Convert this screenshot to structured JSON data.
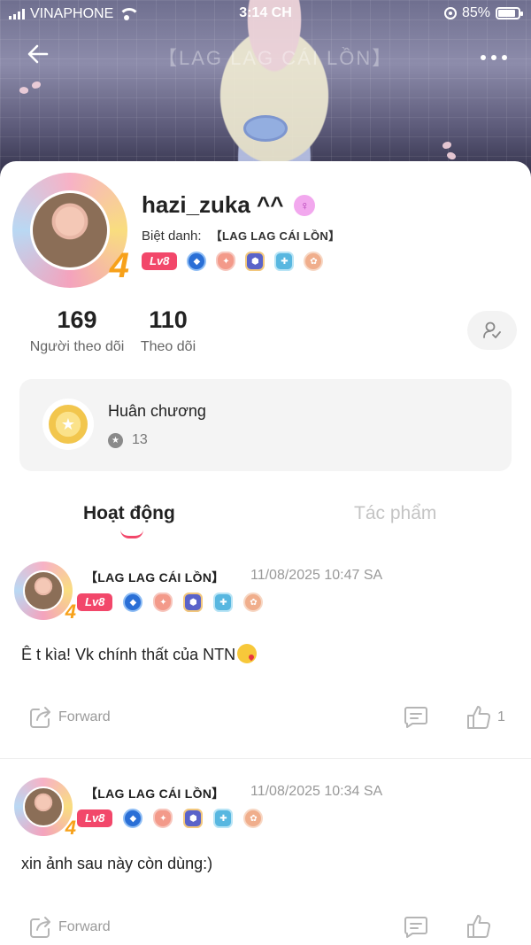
{
  "status_bar": {
    "carrier": "VINAPHONE",
    "time": "3:14 CH",
    "battery_percent": "85%"
  },
  "banner": {
    "background_text": "【LAG LAG CÁI LỒN】"
  },
  "profile": {
    "username": "hazi_zuka ^^",
    "nickname_label": "Biệt danh:",
    "nickname_value": "【LAG LAG CÁI LỒN】",
    "level": "Lv8",
    "avatar_deco": "4",
    "followers_count": "169",
    "followers_label": "Người theo dõi",
    "following_count": "110",
    "following_label": "Theo dõi",
    "gender_icon": "female-icon"
  },
  "medals": {
    "title": "Huân chương",
    "count": "13"
  },
  "tabs": [
    {
      "label": "Hoạt động",
      "active": true
    },
    {
      "label": "Tác phẩm",
      "active": false
    }
  ],
  "posts": [
    {
      "author": "【LAG LAG CÁI LỒN】",
      "timestamp": "11/08/2025 10:47 SA",
      "level": "Lv8",
      "text": "Ê t kìa! Vk chính thất của NTN",
      "forward_label": "Forward",
      "like_count": "1"
    },
    {
      "author": "【LAG LAG CÁI LỒN】",
      "timestamp": "11/08/2025 10:34 SA",
      "level": "Lv8",
      "text": "xin ảnh sau này còn dùng:)",
      "forward_label": "Forward",
      "like_count": ""
    }
  ],
  "colors": {
    "accent": "#f2476a",
    "level_badge": "#f2476a",
    "muted_text": "#999999"
  }
}
